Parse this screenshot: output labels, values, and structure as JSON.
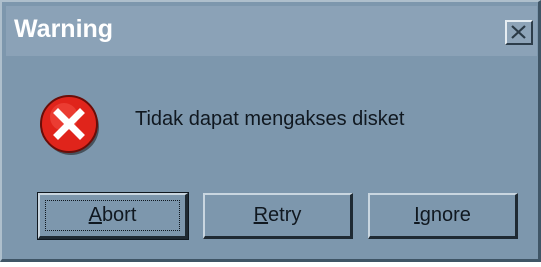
{
  "window": {
    "title": "Warning",
    "close_icon": "close-icon"
  },
  "message": {
    "icon": "error-icon",
    "text": "Tidak dapat mengakses disket"
  },
  "buttons": {
    "abort": {
      "first": "A",
      "rest": "bort"
    },
    "retry": {
      "first": "R",
      "rest": "etry"
    },
    "ignore": {
      "first": "I",
      "rest": "gnore"
    }
  },
  "colors": {
    "dialog_bg": "#7d97ad",
    "titlebar_bg": "#8ba2b7",
    "error_red": "#e0241b"
  }
}
